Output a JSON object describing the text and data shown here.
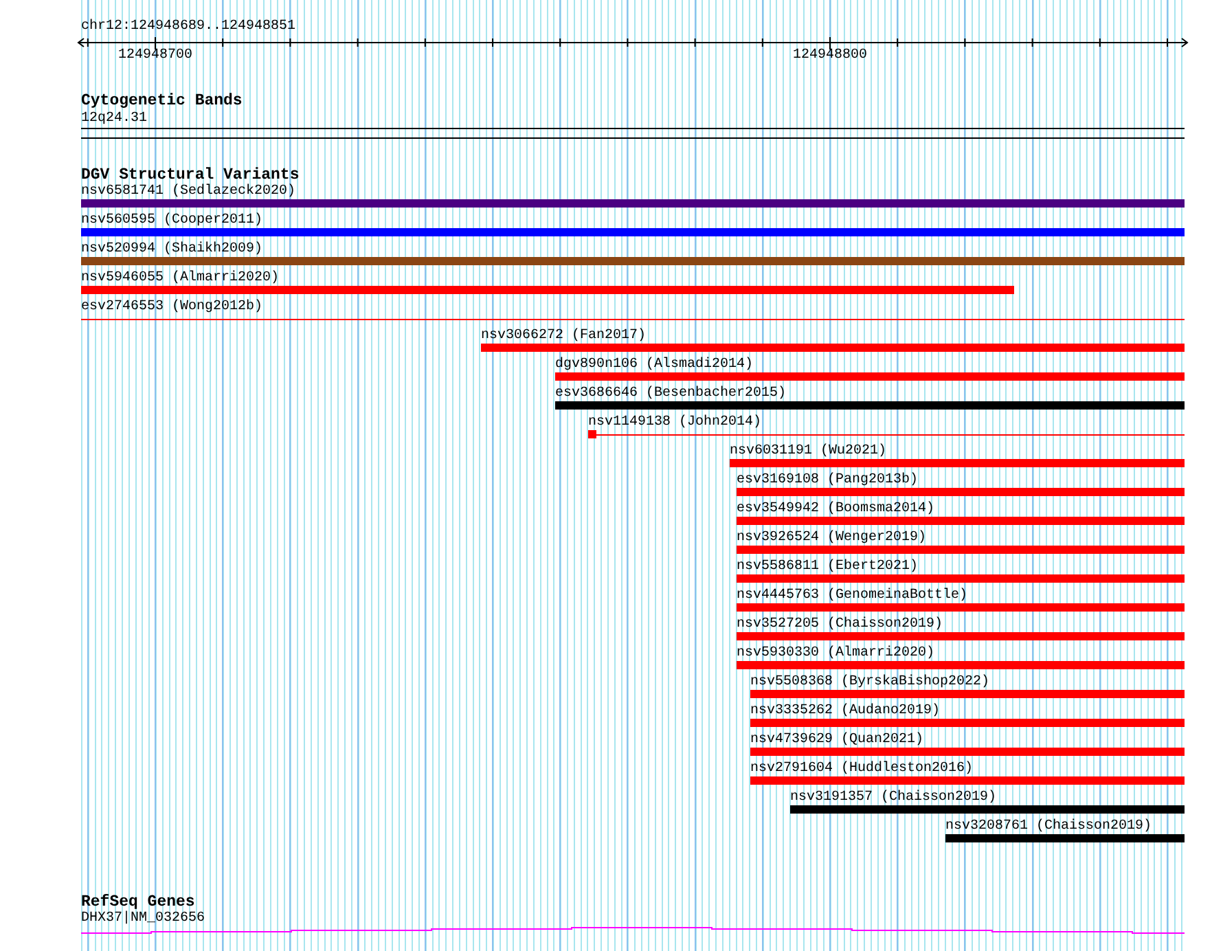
{
  "ruler": {
    "position": "chr12:124948689..124948851",
    "tick_labels": [
      "124948700",
      "124948800"
    ]
  },
  "cytogenetic_bands": {
    "title": "Cytogenetic Bands",
    "band": "12q24.31"
  },
  "dgv_structural_variants": {
    "title": "DGV Structural Variants",
    "variants": [
      {
        "label": "nsv6581741 (Sedlazeck2020)",
        "color": "#4b0082",
        "kind": "bar"
      },
      {
        "label": "nsv560595 (Cooper2011)",
        "color": "#0000ff",
        "kind": "bar"
      },
      {
        "label": "nsv520994 (Shaikh2009)",
        "color": "#8b4513",
        "kind": "bar"
      },
      {
        "label": "nsv5946055 (Almarri2020)",
        "color": "#ff0000",
        "kind": "bar"
      },
      {
        "label": "esv2746553 (Wong2012b)",
        "color": "#ff0000",
        "kind": "thin"
      },
      {
        "label": "nsv3066272 (Fan2017)",
        "color": "#ff0000",
        "kind": "bar"
      },
      {
        "label": "dgv890n106 (Alsmadi2014)",
        "color": "#ff0000",
        "kind": "bar"
      },
      {
        "label": "esv3686646 (Besenbacher2015)",
        "color": "#000000",
        "kind": "bar"
      },
      {
        "label": "nsv1149138 (John2014)",
        "color": "#ff0000",
        "kind": "block"
      },
      {
        "label": "nsv6031191 (Wu2021)",
        "color": "#ff0000",
        "kind": "bar"
      },
      {
        "label": "esv3169108 (Pang2013b)",
        "color": "#ff0000",
        "kind": "bar"
      },
      {
        "label": "esv3549942 (Boomsma2014)",
        "color": "#ff0000",
        "kind": "bar"
      },
      {
        "label": "nsv3926524 (Wenger2019)",
        "color": "#ff0000",
        "kind": "bar"
      },
      {
        "label": "nsv5586811 (Ebert2021)",
        "color": "#ff0000",
        "kind": "bar"
      },
      {
        "label": "nsv4445763 (GenomeinaBottle)",
        "color": "#ff0000",
        "kind": "bar"
      },
      {
        "label": "nsv3527205 (Chaisson2019)",
        "color": "#ff0000",
        "kind": "bar"
      },
      {
        "label": "nsv5930330 (Almarri2020)",
        "color": "#ff0000",
        "kind": "bar"
      },
      {
        "label": "nsv5508368 (ByrskaBishop2022)",
        "color": "#ff0000",
        "kind": "bar"
      },
      {
        "label": "nsv3335262 (Audano2019)",
        "color": "#ff0000",
        "kind": "bar"
      },
      {
        "label": "nsv4739629 (Quan2021)",
        "color": "#ff0000",
        "kind": "bar"
      },
      {
        "label": "nsv2791604 (Huddleston2016)",
        "color": "#ff0000",
        "kind": "bar"
      },
      {
        "label": "nsv3191357 (Chaisson2019)",
        "color": "#000000",
        "kind": "bar"
      },
      {
        "label": "nsv3208761 (Chaisson2019)",
        "color": "#000000",
        "kind": "bar"
      }
    ]
  },
  "refseq_genes": {
    "title": "RefSeq Genes",
    "gene": "DHX37|NM_032656"
  }
}
